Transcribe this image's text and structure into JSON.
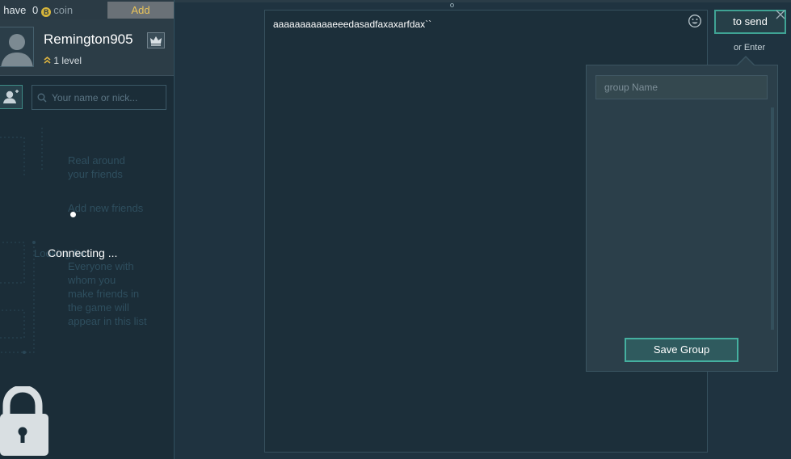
{
  "coinbar": {
    "prefix": "I have",
    "count": "0",
    "coin_symbol": "B",
    "coin_word": "coin",
    "add_label": "Add"
  },
  "profile": {
    "username": "Remington905",
    "level_text": "1 level"
  },
  "search": {
    "placeholder": "Your name or nick..."
  },
  "friends_bg": {
    "line1": "Real around",
    "line2": "your friends",
    "line3": "Add new friends",
    "line4": "Looking for...",
    "line5": "Everyone with",
    "line6": "whom you",
    "line7": "make friends in",
    "line8": "the game will",
    "line9": "appear in this list"
  },
  "status": {
    "connecting": "Connecting ... "
  },
  "chat": {
    "message": "aaaaaaaaaaaeeedasadfaxaxarfdax``",
    "send_label": "to send",
    "hint": "or Enter"
  },
  "group": {
    "name_placeholder": "group Name",
    "save_label": "Save Group"
  },
  "colors": {
    "accent": "#3fa394",
    "coin": "#d7b53a",
    "add_text": "#e9c45a",
    "background": "#1f3340"
  }
}
